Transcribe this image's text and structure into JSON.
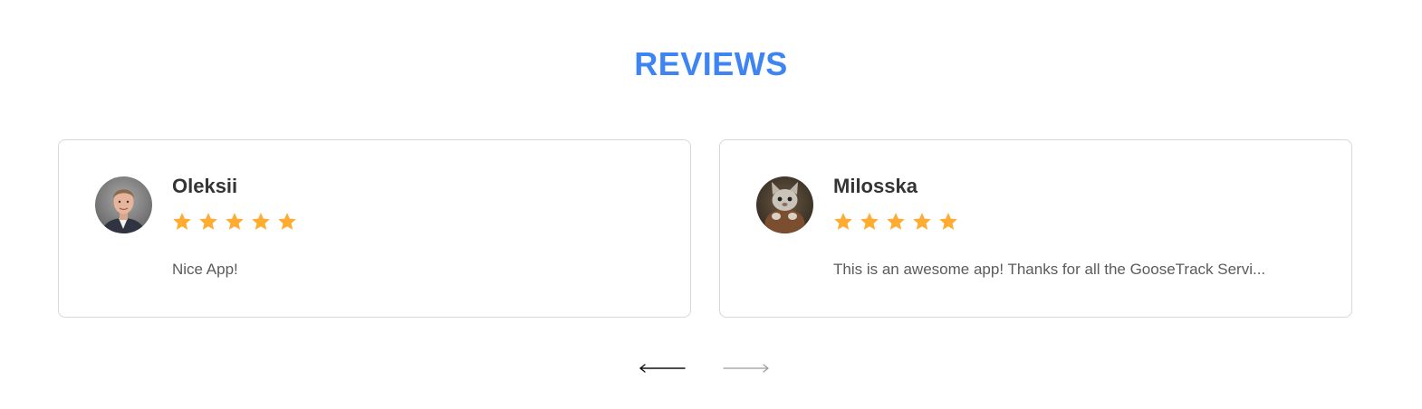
{
  "section": {
    "title": "REVIEWS"
  },
  "colors": {
    "accent": "#3e85f3",
    "star": "#ffac33",
    "border": "#d6d8de",
    "name": "#343434",
    "text": "#5b5b5b",
    "arrow_active": "#111111",
    "arrow_inactive": "#9a9a9a"
  },
  "reviews": [
    {
      "name": "Oleksii",
      "rating": 5,
      "text": "Nice App!",
      "avatar_icon": "user-photo-avatar"
    },
    {
      "name": "Milosska",
      "rating": 5,
      "text": "This is an awesome app! Thanks for all the GooseTrack Servi...",
      "avatar_icon": "cat-photo-avatar"
    }
  ],
  "navigation": {
    "prev_icon": "arrow-left-icon",
    "next_icon": "arrow-right-icon",
    "prev_enabled": true,
    "next_enabled": false
  }
}
